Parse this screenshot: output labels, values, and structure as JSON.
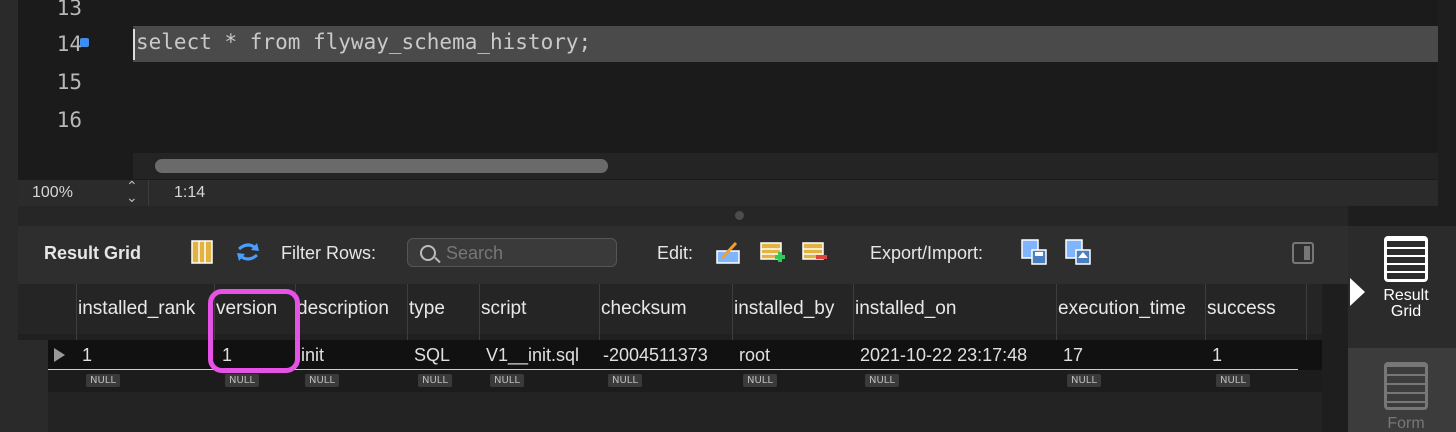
{
  "editor": {
    "lines": [
      {
        "num": "13",
        "text": ""
      },
      {
        "num": "14",
        "text": "select * from flyway_schema_history;"
      },
      {
        "num": "15",
        "text": ""
      },
      {
        "num": "16",
        "text": ""
      }
    ]
  },
  "status": {
    "zoom": "100%",
    "position": "1:14"
  },
  "toolbar": {
    "result_grid_label": "Result Grid",
    "filter_label": "Filter Rows:",
    "search_placeholder": "Search",
    "edit_label": "Edit:",
    "export_label": "Export/Import:"
  },
  "grid": {
    "columns": [
      "installed_rank",
      "version",
      "description",
      "type",
      "script",
      "checksum",
      "installed_by",
      "installed_on",
      "execution_time",
      "success"
    ],
    "rows": [
      [
        "1",
        "1",
        "init",
        "SQL",
        "V1__init.sql",
        "-2004511373",
        "root",
        "2021-10-22 23:17:48",
        "17",
        "1"
      ]
    ],
    "null_label": "NULL"
  },
  "side_panel": {
    "result_grid": "Result Grid",
    "form": "Form"
  },
  "colors": {
    "highlight": "#e651e6",
    "accent": "#3d8ef0"
  }
}
